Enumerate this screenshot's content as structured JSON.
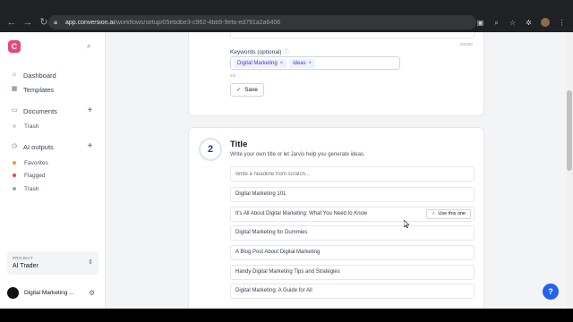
{
  "browser": {
    "url_host": "app.conversion.ai",
    "url_path": "/workflows/setup/05ebdbe3-c962-4bb9-9efa-ed791a2a6406"
  },
  "sidebar": {
    "logo_letter": "C",
    "items": {
      "dashboard": "Dashboard",
      "templates": "Templates",
      "documents": "Documents",
      "documents_trash": "Trash",
      "ai_outputs": "AI outputs",
      "favorites": "Favorites",
      "flagged": "Flagged",
      "ai_trash": "Trash"
    },
    "project": {
      "label": "PROJECT",
      "value": "AI Trader"
    },
    "user": {
      "name": "Digital Marketing ..."
    },
    "dot_colors": {
      "trash": "#d1d5db",
      "favorites": "#f59e0b",
      "flagged": "#ef4444",
      "ai_trash": "#9ca3af"
    }
  },
  "keywords_section": {
    "char_count": "0/4000",
    "label": "Keywords (optional)",
    "chips": [
      "Digital Marketing",
      "ideas"
    ],
    "count": "2/3",
    "save_label": "Save"
  },
  "title_section": {
    "step_number": "2",
    "title": "Title",
    "subtitle": "Write your own title or let Jarvis help you generate ideas.",
    "input_placeholder": "Write a headline from scratch...",
    "options": [
      "Digital Marketing 101",
      "It's All About Digital Marketing: What You Need to Know",
      "Digital Marketing for Dummies",
      "A Blog Post About Digital Marketing",
      "Handy Digital Marketing Tips and Strategies",
      "Digital Marketing: A Guide for All"
    ],
    "use_label": "Use this one"
  },
  "help_label": "?",
  "accent_color": "#e8477c"
}
